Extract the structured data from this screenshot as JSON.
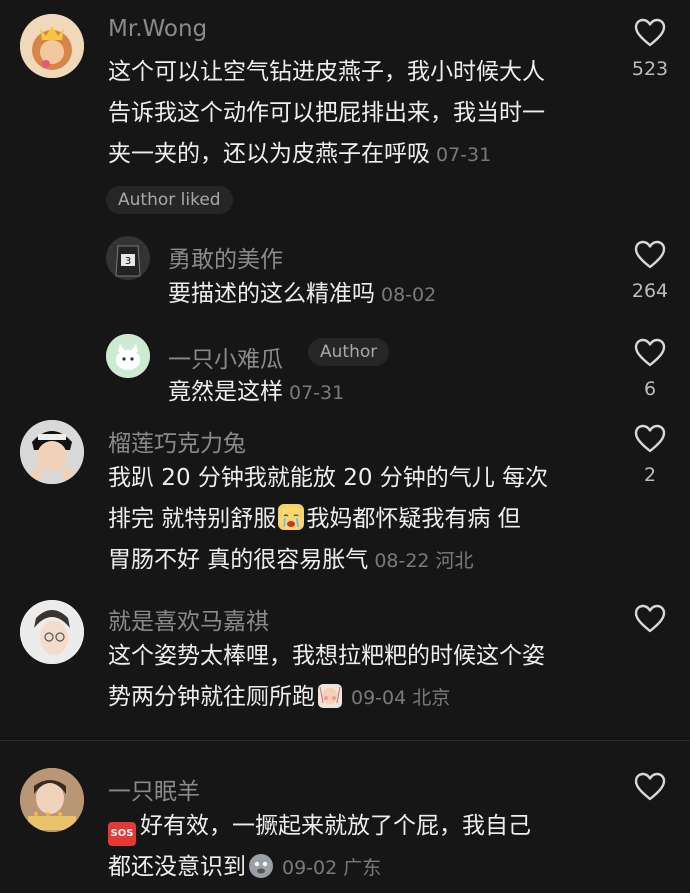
{
  "comments": [
    {
      "username": "Mr.Wong",
      "lines": [
        "这个可以让空气钻进皮燕子，我小时候大人",
        "告诉我这个动作可以把屁排出来，我当时一",
        "夹一夹的，还以为皮燕子在呼吸"
      ],
      "date": "07-31",
      "likes": "523",
      "badge": "Author liked"
    },
    {
      "username": "勇敢的美作",
      "lines": [
        "要描述的这么精准吗"
      ],
      "date": "08-02",
      "likes": "264"
    },
    {
      "username": "一只小难瓜",
      "author_tag": "Author",
      "lines": [
        "竟然是这样"
      ],
      "date": "07-31",
      "likes": "6"
    },
    {
      "username": "榴莲巧克力兔",
      "lines": [
        "我趴 20 分钟我就能放 20 分钟的气儿 每次",
        "排完 就特别舒服",
        "我妈都怀疑我有病 但",
        "胃肠不好 真的很容易胀气"
      ],
      "date": "08-22",
      "location": "河北",
      "likes": "2"
    },
    {
      "username": "就是喜欢马嘉祺",
      "lines": [
        "这个姿势太棒哩，我想拉粑粑的时候这个姿",
        "势两分钟就往厕所跑"
      ],
      "date": "09-04",
      "location": "北京"
    },
    {
      "username": "一只眠羊",
      "lines": [
        "好有效，一撅起来就放了个屁，我自己",
        "都还没意识到"
      ],
      "date": "09-02",
      "location": "广东",
      "sos": "SOS"
    }
  ],
  "icons": {
    "like": "heart-outline-icon",
    "cry": "crying-emoji-icon",
    "shy": "shy-emoji-icon",
    "sos": "sos-emoji-icon",
    "ghost": "ghost-emoji-icon"
  },
  "colors": {
    "background": "#161616",
    "text": "#eeeeee",
    "muted": "#8a8a8a"
  }
}
